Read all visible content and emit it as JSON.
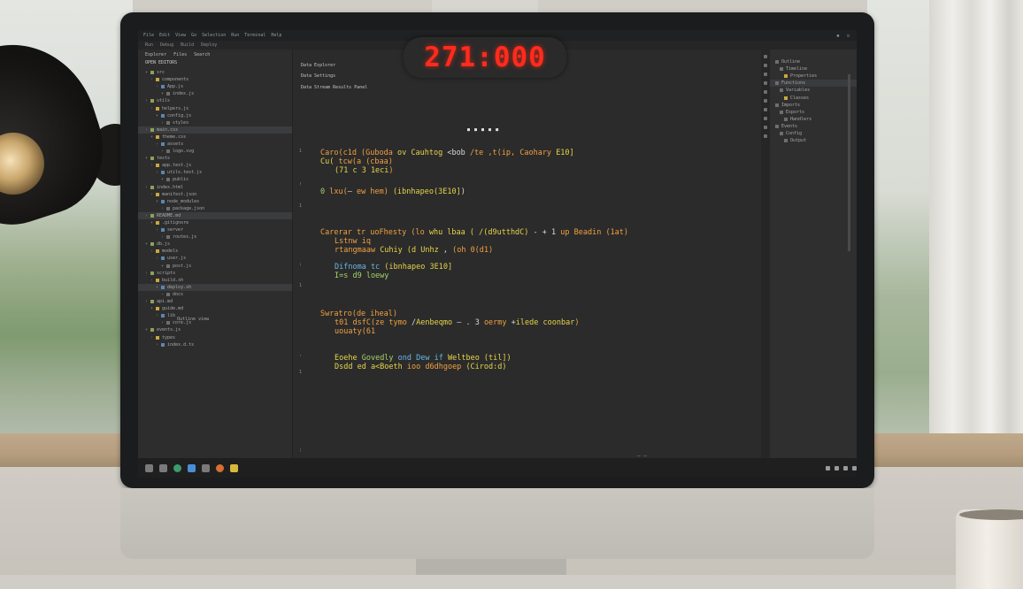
{
  "scene": {
    "objects": [
      "desk-lamp",
      "monitor",
      "coffee-mug",
      "window",
      "curtain"
    ]
  },
  "clock": {
    "display": "271:000",
    "color": "#ff2b1c"
  },
  "ide": {
    "menu": [
      "File",
      "Edit",
      "View",
      "Go",
      "Selection",
      "Run",
      "Terminal",
      "Help"
    ],
    "toolbar": [
      "Run",
      "Debug",
      "Build",
      "Deploy"
    ],
    "explorer": {
      "tabs": [
        "Explorer",
        "Files",
        "Search"
      ],
      "title": "OPEN EDITORS",
      "footer": "Outline view",
      "rows": [
        "src",
        "components",
        "App.js",
        "index.js",
        "utils",
        "helpers.js",
        "config.js",
        "styles",
        "main.css",
        "theme.css",
        "assets",
        "logo.svg",
        "tests",
        "app.test.js",
        "utils.test.js",
        "public",
        "index.html",
        "manifest.json",
        "node_modules",
        "package.json",
        "README.md",
        ".gitignore",
        "server",
        "routes.js",
        "db.js",
        "models",
        "user.js",
        "post.js",
        "scripts",
        "build.sh",
        "deploy.sh",
        "docs",
        "api.md",
        "guide.md",
        "lib",
        "core.js",
        "events.js",
        "types",
        "index.d.ts"
      ]
    },
    "editor": {
      "tabs": [
        "Data Explorer",
        "Data Settings"
      ],
      "header": "Data Stream Results Panel",
      "center_mark": "■ ■ ■ ■ ■",
      "bottom_mark": "— —"
    },
    "outline": {
      "rows": [
        "Outline",
        "Timeline",
        "Properties",
        "Functions",
        "Variables",
        "Classes",
        "Imports",
        "Exports",
        "Handlers",
        "Events",
        "Config",
        "Output"
      ]
    },
    "colors": {
      "editor_bg": "#2b2b2b",
      "orange": "#f0a040",
      "yellow": "#e6d44a",
      "green": "#a6d36a",
      "blue": "#66b7e6"
    }
  }
}
